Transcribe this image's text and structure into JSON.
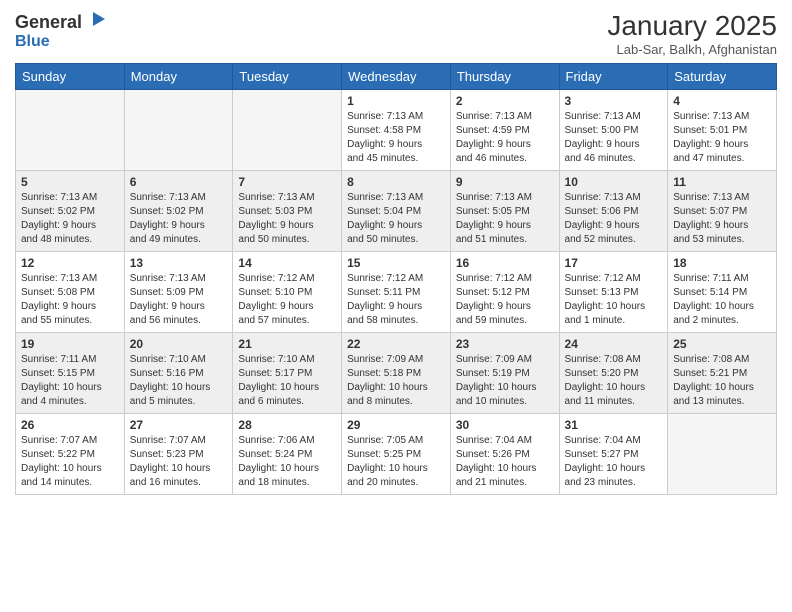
{
  "header": {
    "logo_general": "General",
    "logo_blue": "Blue",
    "month_title": "January 2025",
    "location": "Lab-Sar, Balkh, Afghanistan"
  },
  "weekdays": [
    "Sunday",
    "Monday",
    "Tuesday",
    "Wednesday",
    "Thursday",
    "Friday",
    "Saturday"
  ],
  "weeks": [
    [
      {
        "num": "",
        "info": "",
        "empty": true
      },
      {
        "num": "",
        "info": "",
        "empty": true
      },
      {
        "num": "",
        "info": "",
        "empty": true
      },
      {
        "num": "1",
        "info": "Sunrise: 7:13 AM\nSunset: 4:58 PM\nDaylight: 9 hours\nand 45 minutes."
      },
      {
        "num": "2",
        "info": "Sunrise: 7:13 AM\nSunset: 4:59 PM\nDaylight: 9 hours\nand 46 minutes."
      },
      {
        "num": "3",
        "info": "Sunrise: 7:13 AM\nSunset: 5:00 PM\nDaylight: 9 hours\nand 46 minutes."
      },
      {
        "num": "4",
        "info": "Sunrise: 7:13 AM\nSunset: 5:01 PM\nDaylight: 9 hours\nand 47 minutes."
      }
    ],
    [
      {
        "num": "5",
        "info": "Sunrise: 7:13 AM\nSunset: 5:02 PM\nDaylight: 9 hours\nand 48 minutes."
      },
      {
        "num": "6",
        "info": "Sunrise: 7:13 AM\nSunset: 5:02 PM\nDaylight: 9 hours\nand 49 minutes."
      },
      {
        "num": "7",
        "info": "Sunrise: 7:13 AM\nSunset: 5:03 PM\nDaylight: 9 hours\nand 50 minutes."
      },
      {
        "num": "8",
        "info": "Sunrise: 7:13 AM\nSunset: 5:04 PM\nDaylight: 9 hours\nand 50 minutes."
      },
      {
        "num": "9",
        "info": "Sunrise: 7:13 AM\nSunset: 5:05 PM\nDaylight: 9 hours\nand 51 minutes."
      },
      {
        "num": "10",
        "info": "Sunrise: 7:13 AM\nSunset: 5:06 PM\nDaylight: 9 hours\nand 52 minutes."
      },
      {
        "num": "11",
        "info": "Sunrise: 7:13 AM\nSunset: 5:07 PM\nDaylight: 9 hours\nand 53 minutes."
      }
    ],
    [
      {
        "num": "12",
        "info": "Sunrise: 7:13 AM\nSunset: 5:08 PM\nDaylight: 9 hours\nand 55 minutes."
      },
      {
        "num": "13",
        "info": "Sunrise: 7:13 AM\nSunset: 5:09 PM\nDaylight: 9 hours\nand 56 minutes."
      },
      {
        "num": "14",
        "info": "Sunrise: 7:12 AM\nSunset: 5:10 PM\nDaylight: 9 hours\nand 57 minutes."
      },
      {
        "num": "15",
        "info": "Sunrise: 7:12 AM\nSunset: 5:11 PM\nDaylight: 9 hours\nand 58 minutes."
      },
      {
        "num": "16",
        "info": "Sunrise: 7:12 AM\nSunset: 5:12 PM\nDaylight: 9 hours\nand 59 minutes."
      },
      {
        "num": "17",
        "info": "Sunrise: 7:12 AM\nSunset: 5:13 PM\nDaylight: 10 hours\nand 1 minute."
      },
      {
        "num": "18",
        "info": "Sunrise: 7:11 AM\nSunset: 5:14 PM\nDaylight: 10 hours\nand 2 minutes."
      }
    ],
    [
      {
        "num": "19",
        "info": "Sunrise: 7:11 AM\nSunset: 5:15 PM\nDaylight: 10 hours\nand 4 minutes."
      },
      {
        "num": "20",
        "info": "Sunrise: 7:10 AM\nSunset: 5:16 PM\nDaylight: 10 hours\nand 5 minutes."
      },
      {
        "num": "21",
        "info": "Sunrise: 7:10 AM\nSunset: 5:17 PM\nDaylight: 10 hours\nand 6 minutes."
      },
      {
        "num": "22",
        "info": "Sunrise: 7:09 AM\nSunset: 5:18 PM\nDaylight: 10 hours\nand 8 minutes."
      },
      {
        "num": "23",
        "info": "Sunrise: 7:09 AM\nSunset: 5:19 PM\nDaylight: 10 hours\nand 10 minutes."
      },
      {
        "num": "24",
        "info": "Sunrise: 7:08 AM\nSunset: 5:20 PM\nDaylight: 10 hours\nand 11 minutes."
      },
      {
        "num": "25",
        "info": "Sunrise: 7:08 AM\nSunset: 5:21 PM\nDaylight: 10 hours\nand 13 minutes."
      }
    ],
    [
      {
        "num": "26",
        "info": "Sunrise: 7:07 AM\nSunset: 5:22 PM\nDaylight: 10 hours\nand 14 minutes."
      },
      {
        "num": "27",
        "info": "Sunrise: 7:07 AM\nSunset: 5:23 PM\nDaylight: 10 hours\nand 16 minutes."
      },
      {
        "num": "28",
        "info": "Sunrise: 7:06 AM\nSunset: 5:24 PM\nDaylight: 10 hours\nand 18 minutes."
      },
      {
        "num": "29",
        "info": "Sunrise: 7:05 AM\nSunset: 5:25 PM\nDaylight: 10 hours\nand 20 minutes."
      },
      {
        "num": "30",
        "info": "Sunrise: 7:04 AM\nSunset: 5:26 PM\nDaylight: 10 hours\nand 21 minutes."
      },
      {
        "num": "31",
        "info": "Sunrise: 7:04 AM\nSunset: 5:27 PM\nDaylight: 10 hours\nand 23 minutes."
      },
      {
        "num": "",
        "info": "",
        "empty": true
      }
    ]
  ]
}
